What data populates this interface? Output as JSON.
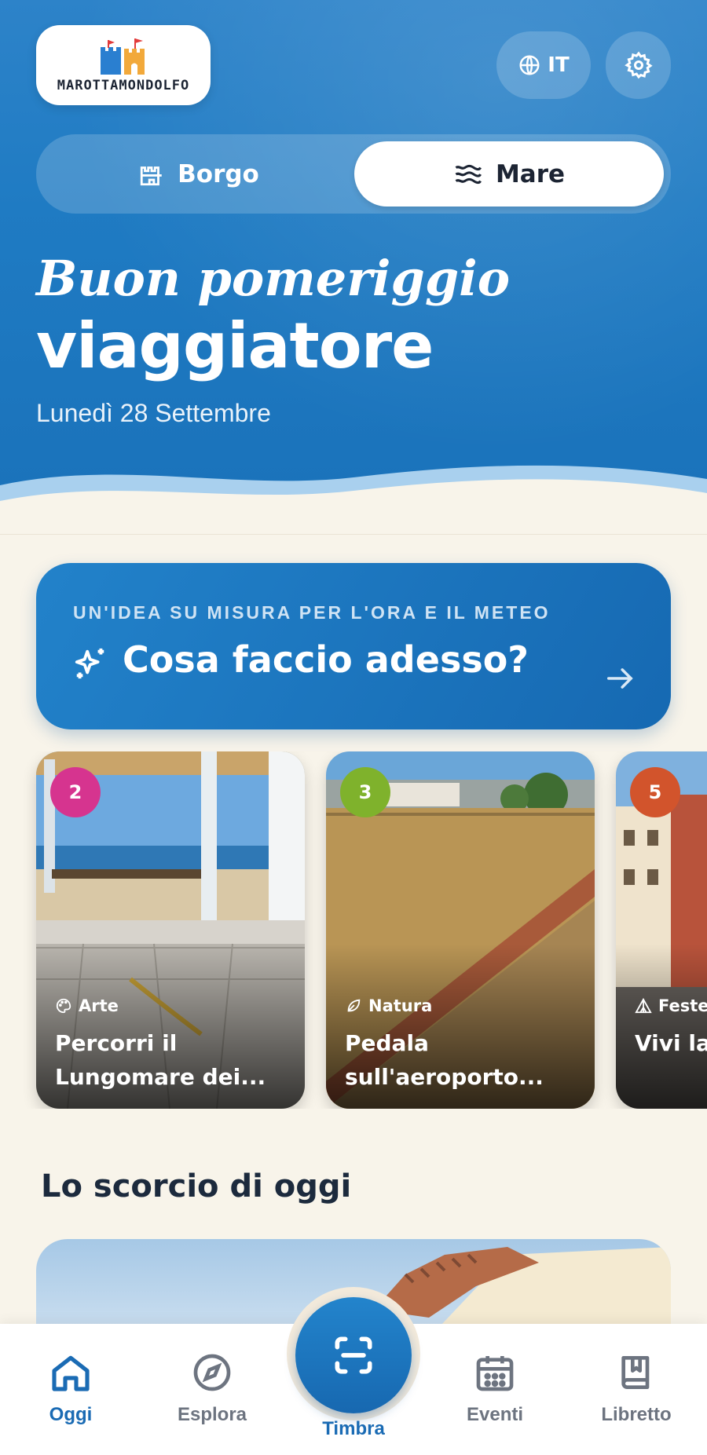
{
  "header": {
    "logo_text": "MAROTTAMONDOLFO",
    "language": "IT",
    "icons": {
      "language": "globe-icon",
      "settings": "gear-icon"
    }
  },
  "mode_toggle": {
    "options": [
      {
        "label": "Borgo",
        "icon": "castle-icon",
        "selected": false
      },
      {
        "label": "Mare",
        "icon": "waves-icon",
        "selected": true
      }
    ]
  },
  "greeting": {
    "line1": "Buon pomeriggio",
    "line2": "viaggiatore",
    "date": "Lunedì 28 Settembre"
  },
  "idea_card": {
    "kicker": "UN'IDEA SU MISURA PER L'ORA E IL METEO",
    "title": "Cosa faccio adesso?",
    "icons": {
      "spark": "sparkles-icon",
      "arrow": "arrow-right-icon"
    }
  },
  "cards": [
    {
      "number": "2",
      "category": "Arte",
      "category_icon": "palette-icon",
      "title": "Percorri il Lungomare dei...",
      "badge_color": "#d6348f"
    },
    {
      "number": "3",
      "category": "Natura",
      "category_icon": "leaf-icon",
      "title": "Pedala sull'aeroporto...",
      "badge_color": "#7fb22c"
    },
    {
      "number": "5",
      "category": "Feste",
      "category_icon": "tent-icon",
      "title": "Vivi la Marotta...",
      "badge_color": "#d2542c"
    }
  ],
  "section": {
    "title": "Lo scorcio di oggi"
  },
  "nav": {
    "items": [
      {
        "label": "Oggi",
        "icon": "home-icon",
        "active": true
      },
      {
        "label": "Esplora",
        "icon": "compass-icon",
        "active": false
      },
      {
        "label": "Timbra",
        "icon": "scan-icon",
        "active": false
      },
      {
        "label": "Eventi",
        "icon": "calendar-icon",
        "active": false
      },
      {
        "label": "Libretto",
        "icon": "book-icon",
        "active": false
      }
    ]
  },
  "colors": {
    "primary": "#1a72ba",
    "background": "#f8f4ea",
    "text_dark": "#1c2a3d"
  }
}
